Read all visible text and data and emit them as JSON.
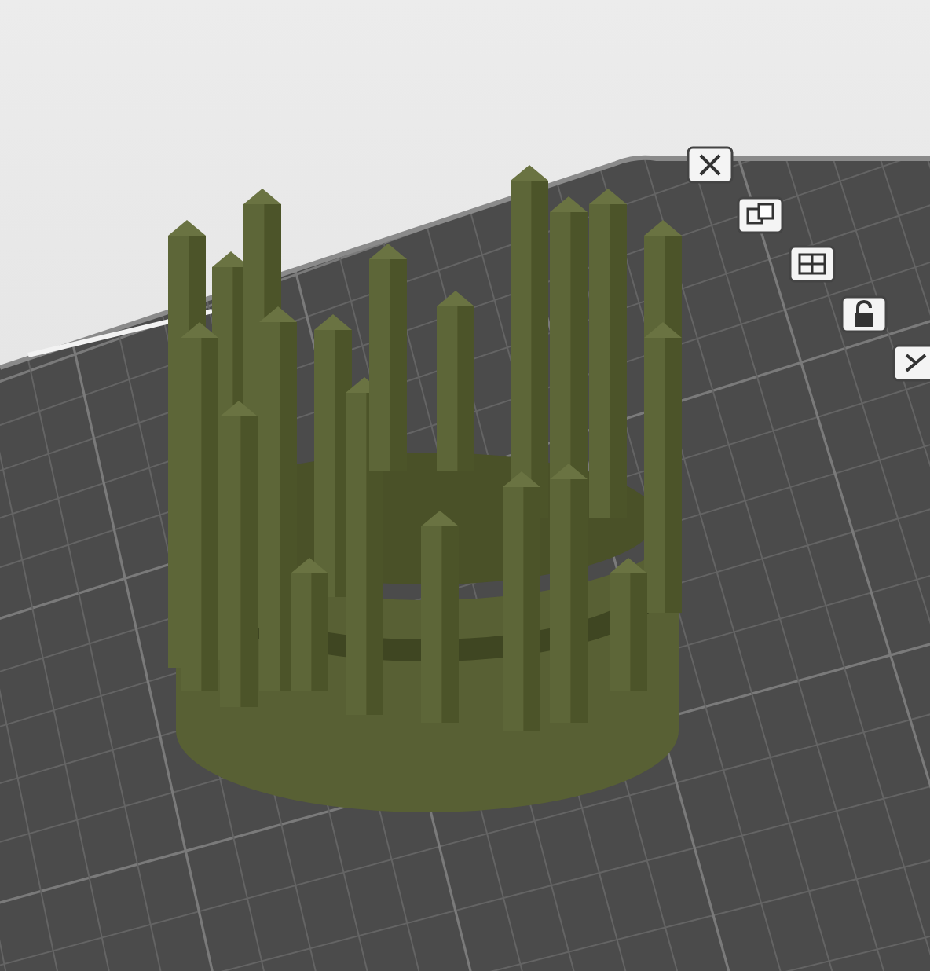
{
  "viewport": {
    "toolbar": [
      {
        "kind": "delete"
      },
      {
        "kind": "arrange"
      },
      {
        "kind": "layers"
      },
      {
        "kind": "lock"
      },
      {
        "kind": "cut"
      }
    ]
  }
}
